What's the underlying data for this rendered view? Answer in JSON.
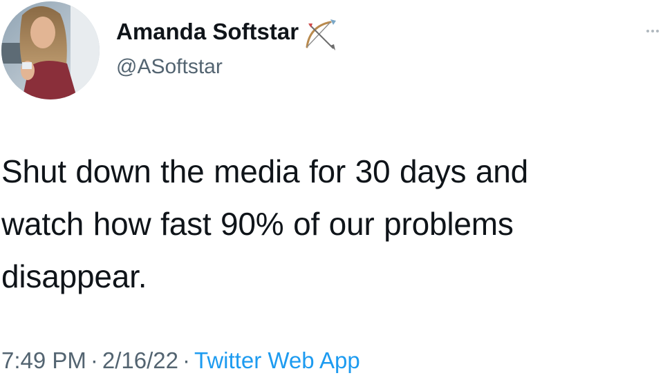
{
  "tweet": {
    "author": {
      "display_name": "Amanda Softstar",
      "name_emoji": "bow-and-arrow-icon",
      "handle": "@ASoftstar"
    },
    "text_lines": [
      "Shut down the media for 30 days and",
      "watch how fast 90% of our problems",
      "disappear."
    ],
    "meta": {
      "time": "7:49 PM",
      "separator": "·",
      "date": "2/16/22",
      "source": "Twitter Web App"
    },
    "more_icon": "more-dots-icon"
  },
  "colors": {
    "text_primary": "#0f1419",
    "text_secondary": "#536471",
    "link": "#1d9bf0",
    "background": "#ffffff"
  }
}
